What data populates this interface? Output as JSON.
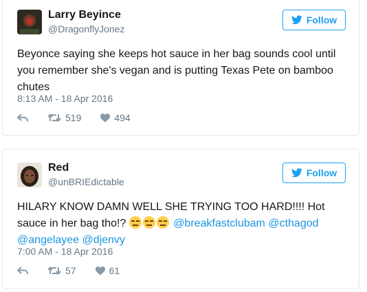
{
  "tweets": [
    {
      "name": "Larry Beyince",
      "handle": "@DragonflyJonez",
      "follow_label": "Follow",
      "text": "Beyonce saying she keeps hot sauce in her bag sounds cool until you remember she's vegan and is putting Texas Pete on bamboo chutes",
      "timestamp": "8:13 AM - 18 Apr 2016",
      "retweets": "519",
      "likes": "494"
    },
    {
      "name": "Red",
      "handle": "@unBRIEdictable",
      "follow_label": "Follow",
      "text_plain": "HILARY KNOW DAMN WELL SHE TRYING TOO HARD!!!! Hot sauce in her bag tho!?",
      "mentions": [
        "@breakfastclubam",
        "@cthagod",
        "@angelayee",
        "@djenvy"
      ],
      "timestamp": "7:00 AM - 18 Apr 2016",
      "retweets": "57",
      "likes": "61"
    }
  ],
  "icons": {
    "twitter_bird": "twitter-bird-icon",
    "reply": "reply-icon",
    "retweet": "retweet-icon",
    "like": "heart-icon"
  },
  "colors": {
    "brand_blue": "#1da1f2",
    "link_blue": "#1b95e0",
    "muted": "#657786",
    "border": "#e1e8ed"
  }
}
